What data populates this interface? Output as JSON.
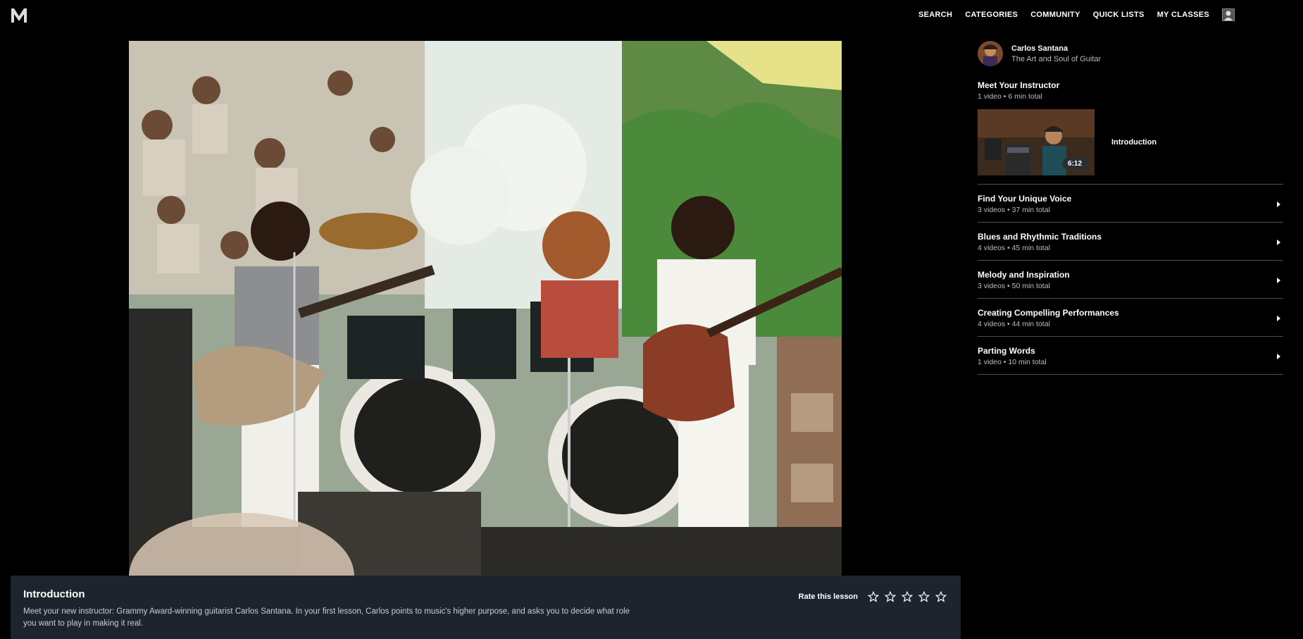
{
  "nav": {
    "logo": "M",
    "items": [
      "SEARCH",
      "CATEGORIES",
      "COMMUNITY",
      "QUICK LISTS",
      "MY CLASSES"
    ]
  },
  "lesson": {
    "title": "Introduction",
    "description": "Meet your new instructor: Grammy Award-winning guitarist Carlos Santana. In your first lesson, Carlos points to music's higher purpose, and asks you to decide what role you want to play in making it real.",
    "rate_label": "Rate this lesson",
    "rating": 0,
    "max_rating": 5
  },
  "course": {
    "instructor": "Carlos Santana",
    "subtitle": "The Art and Soul of Guitar"
  },
  "first_section": {
    "title": "Meet Your Instructor",
    "meta": "1 video • 6 min total",
    "lesson_title": "Introduction",
    "lesson_duration": "6:12"
  },
  "sections": [
    {
      "title": "Find Your Unique Voice",
      "meta": "3 videos • 37 min total"
    },
    {
      "title": "Blues and Rhythmic Traditions",
      "meta": "4 videos • 45 min total"
    },
    {
      "title": "Melody and Inspiration",
      "meta": "3 videos • 50 min total"
    },
    {
      "title": "Creating Compelling Performances",
      "meta": "4 videos • 44 min total"
    },
    {
      "title": "Parting Words",
      "meta": "1 video • 10 min total"
    }
  ],
  "colors": {
    "background": "#000000",
    "panel": "#1e242d",
    "divider": "#4a4f56",
    "muted_text": "#b9bec5"
  }
}
